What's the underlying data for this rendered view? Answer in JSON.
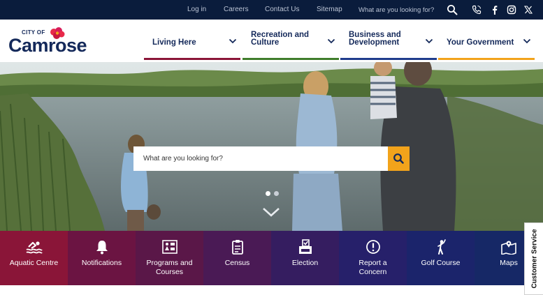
{
  "utility": {
    "links": [
      {
        "label": "Log in"
      },
      {
        "label": "Careers"
      },
      {
        "label": "Contact Us"
      },
      {
        "label": "Sitemap"
      }
    ],
    "search_placeholder": "What are you looking for?"
  },
  "logo": {
    "small": "CITY OF",
    "main": "Camrose"
  },
  "nav": [
    {
      "line1": "Living Here",
      "line2": "",
      "accent": "#8a1538"
    },
    {
      "line1": "Recreation and",
      "line2": "Culture",
      "accent": "#3f7d2b"
    },
    {
      "line1": "Business and",
      "line2": "Development",
      "accent": "#1f3c8c"
    },
    {
      "line1": "Your Government",
      "line2": "",
      "accent": "#f2a31b"
    }
  ],
  "hero": {
    "search_placeholder": "What are you looking for?",
    "slides": {
      "count": 2,
      "active": 1
    }
  },
  "quick_links": [
    {
      "line1": "Aquatic Centre",
      "line2": "",
      "icon": "swimmer-icon",
      "color": "#8a1538"
    },
    {
      "line1": "Notifications",
      "line2": "",
      "icon": "bell-icon",
      "color": "#6b1442"
    },
    {
      "line1": "Programs and",
      "line2": "Courses",
      "icon": "activities-icon",
      "color": "#5a1748"
    },
    {
      "line1": "Census",
      "line2": "",
      "icon": "clipboard-icon",
      "color": "#4a1a55"
    },
    {
      "line1": "Election",
      "line2": "",
      "icon": "ballot-box-icon",
      "color": "#351d60"
    },
    {
      "line1": "Report a",
      "line2": "Concern",
      "icon": "exclamation-icon",
      "color": "#26206a"
    },
    {
      "line1": "Golf Course",
      "line2": "",
      "icon": "golfer-icon",
      "color": "#1b246b"
    },
    {
      "line1": "Maps",
      "line2": "",
      "icon": "map-icon",
      "color": "#162866"
    }
  ],
  "customer_service": "Customer Service",
  "colors": {
    "navy": "#0a1c3c",
    "brand_blue": "#14295a",
    "search_orange": "#f2a31b"
  }
}
